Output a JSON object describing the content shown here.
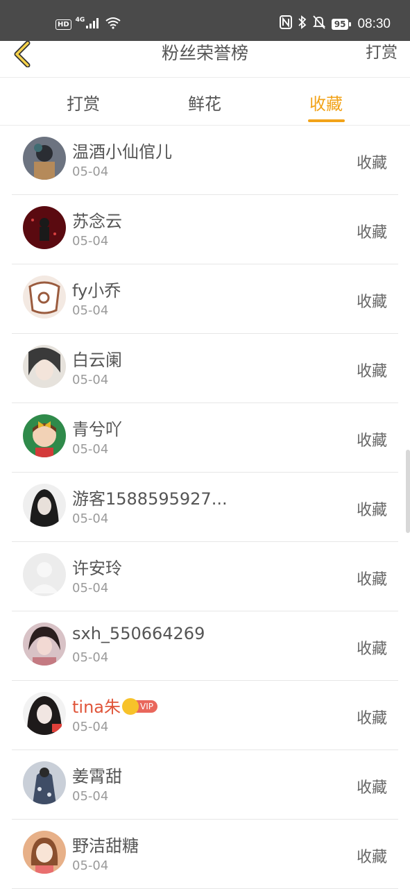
{
  "status_bar": {
    "hd": "HD",
    "network": "4G",
    "battery": "95",
    "time": "08:30"
  },
  "header": {
    "title": "粉丝荣誉榜",
    "action": "打赏"
  },
  "tabs": [
    {
      "label": "打赏",
      "active": false
    },
    {
      "label": "鲜花",
      "active": false
    },
    {
      "label": "收藏",
      "active": true
    }
  ],
  "colors": {
    "accent": "#f2a319",
    "vip_name": "#e0553a",
    "status_bar_bg": "#4a4a4a"
  },
  "rows": [
    {
      "name": "温酒小仙倌儿",
      "date": "05-04",
      "action": "收藏",
      "avatar_color": "#5a5f6a"
    },
    {
      "name": "苏念云",
      "date": "05-04",
      "action": "收藏",
      "avatar_color": "#6a0d12"
    },
    {
      "name": "fy小乔",
      "date": "05-04",
      "action": "收藏",
      "avatar_color": "#e8d8cf"
    },
    {
      "name": "白云阑",
      "date": "05-04",
      "action": "收藏",
      "avatar_color": "#c9c3bb"
    },
    {
      "name": "青兮吖",
      "date": "05-04",
      "action": "收藏",
      "avatar_color": "#2f8a4a"
    },
    {
      "name": "游客1588595927...",
      "date": "05-04",
      "action": "收藏",
      "avatar_color": "#2b2b2b"
    },
    {
      "name": "许安玲",
      "date": "05-04",
      "action": "收藏",
      "avatar_color": "#eeeeee"
    },
    {
      "name": "sxh_550664269",
      "date": "05-04",
      "action": "收藏",
      "avatar_color": "#b98a86"
    },
    {
      "name": "tina朱",
      "date": "05-04",
      "action": "收藏",
      "avatar_color": "#3a3030",
      "vip": "VIP"
    },
    {
      "name": "姜霄甜",
      "date": "05-04",
      "action": "收藏",
      "avatar_color": "#7c8594"
    },
    {
      "name": "野洁甜糖",
      "date": "05-04",
      "action": "收藏",
      "avatar_color": "#e2a983"
    }
  ]
}
